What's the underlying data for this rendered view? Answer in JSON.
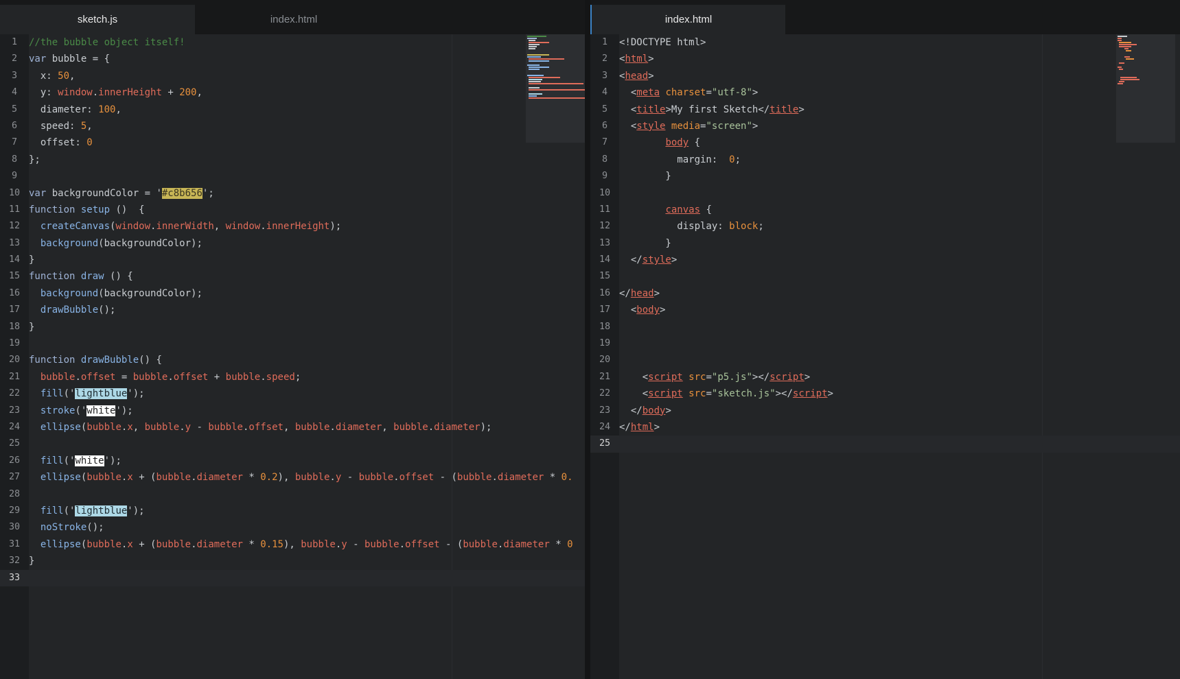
{
  "left_tabs": [
    {
      "label": "sketch.js",
      "active": true
    },
    {
      "label": "index.html",
      "active": false
    }
  ],
  "right_tabs": [
    {
      "label": "index.html",
      "active": true
    }
  ],
  "colors": {
    "background_color_swatch": "#c8b656",
    "lightblue": "#add8e6",
    "white": "#ffffff"
  },
  "left_editor": {
    "file": "sketch.js",
    "line_count": 33,
    "cursor_line": 33
  },
  "right_editor": {
    "file": "index.html",
    "line_count": 25,
    "cursor_line": 25
  }
}
